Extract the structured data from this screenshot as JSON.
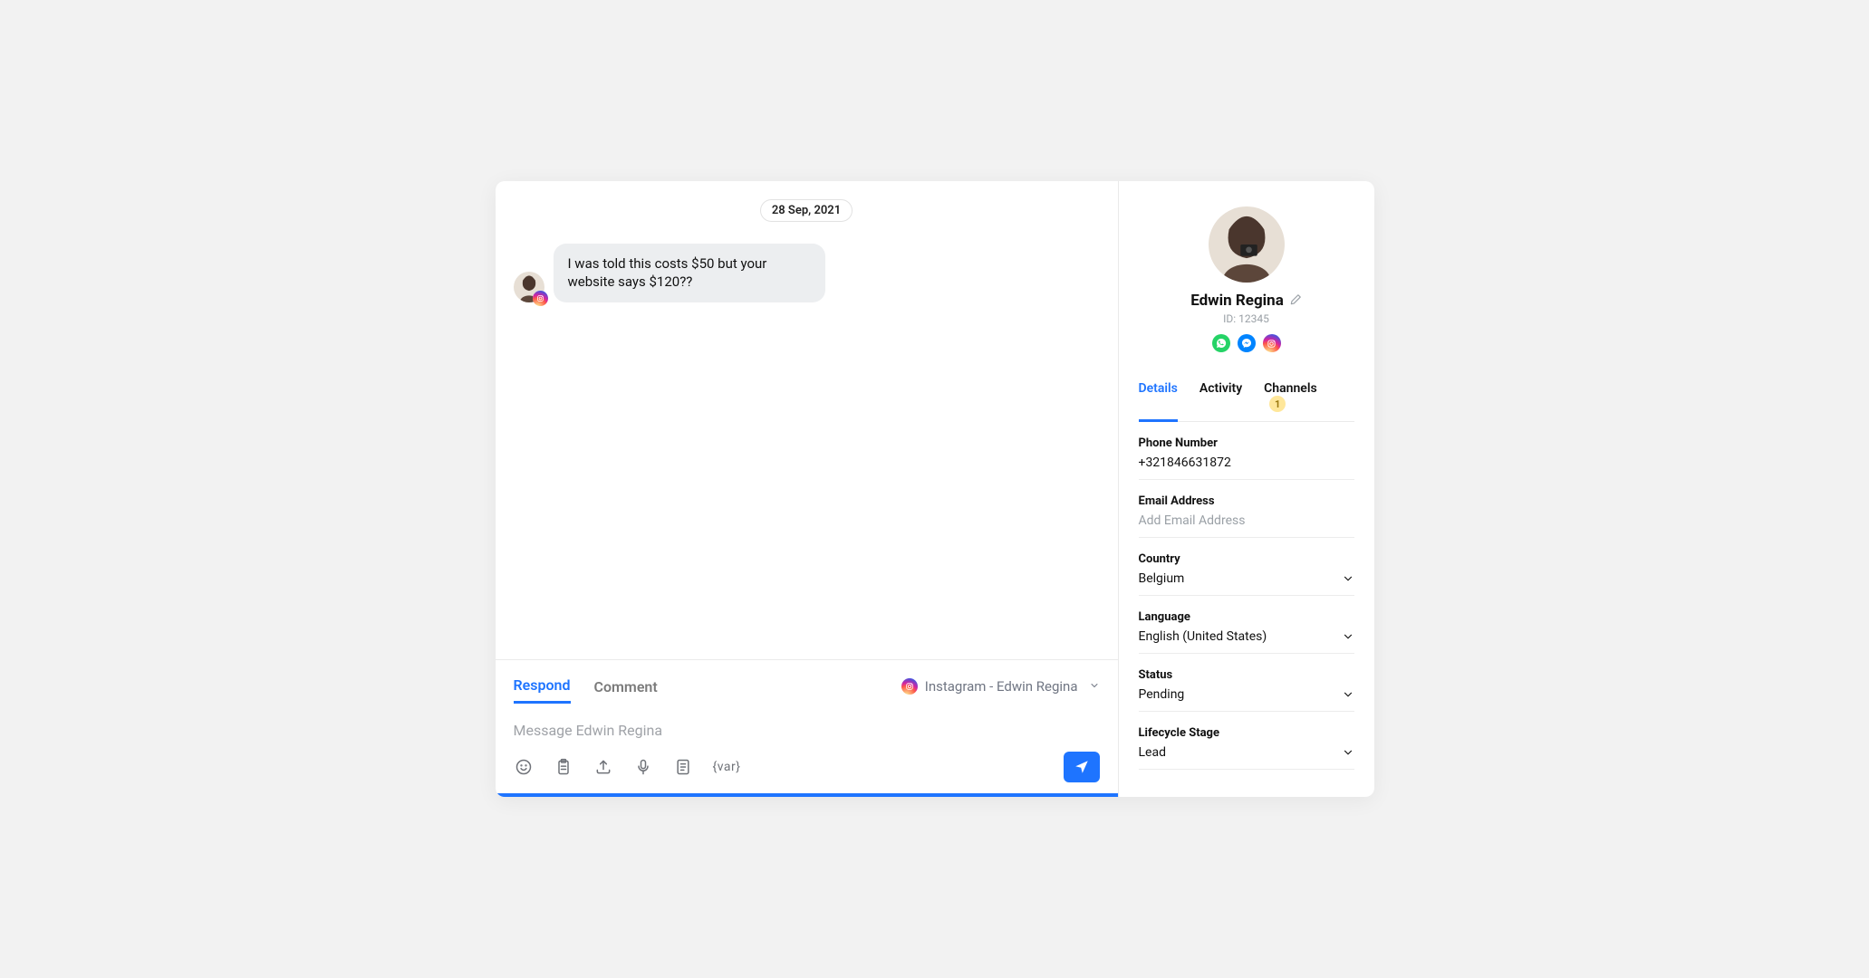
{
  "conversation": {
    "date": "28 Sep, 2021",
    "messages": [
      {
        "text": "I was told this costs $50 but your website says $120??",
        "channel": "instagram"
      }
    ]
  },
  "composer": {
    "tabs": {
      "respond": "Respond",
      "comment": "Comment"
    },
    "channel_label": "Instagram - Edwin Regina",
    "placeholder": "Message Edwin Regina",
    "var_token": "{var}"
  },
  "profile": {
    "name": "Edwin Regina",
    "id_label": "ID: 12345",
    "channels": [
      "whatsapp",
      "messenger",
      "instagram"
    ]
  },
  "tabs": {
    "details": "Details",
    "activity": "Activity",
    "channels": "Channels",
    "channels_badge": "1"
  },
  "details": {
    "phone": {
      "label": "Phone Number",
      "value": "+321846631872"
    },
    "email": {
      "label": "Email Address",
      "placeholder": "Add Email Address"
    },
    "country": {
      "label": "Country",
      "value": "Belgium"
    },
    "language": {
      "label": "Language",
      "value": "English (United States)"
    },
    "status": {
      "label": "Status",
      "value": "Pending"
    },
    "lifecycle": {
      "label": "Lifecycle Stage",
      "value": "Lead"
    }
  }
}
